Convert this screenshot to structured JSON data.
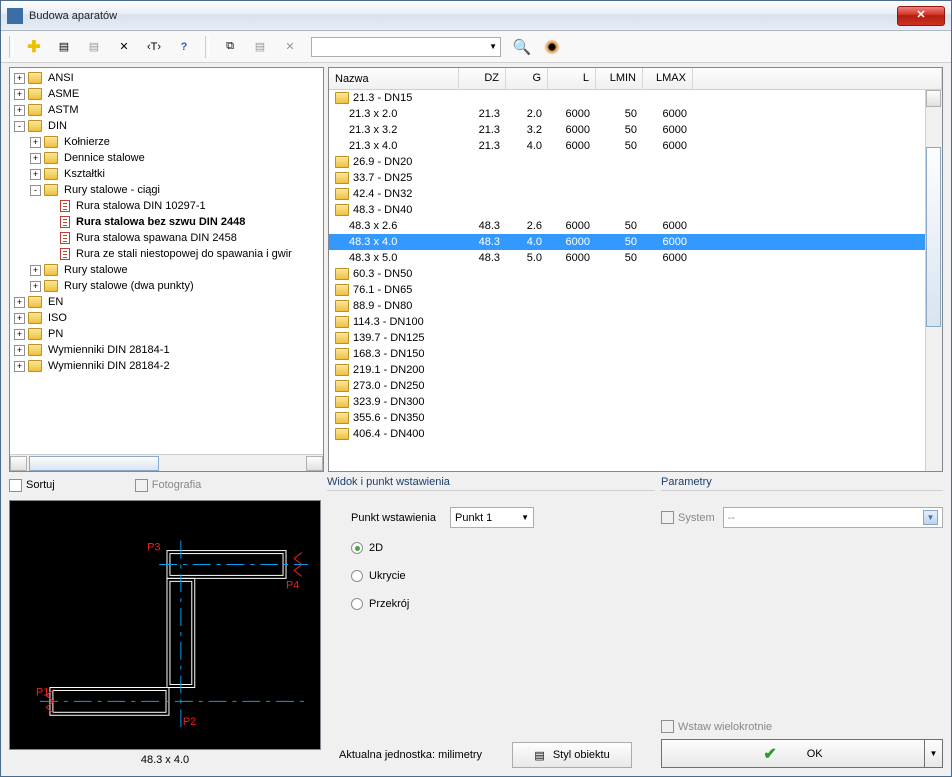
{
  "window": {
    "title": "Budowa aparatów"
  },
  "tree": [
    {
      "d": 0,
      "exp": "+",
      "icon": "folder",
      "label": "ANSI"
    },
    {
      "d": 0,
      "exp": "+",
      "icon": "folder",
      "label": "ASME"
    },
    {
      "d": 0,
      "exp": "+",
      "icon": "folder",
      "label": "ASTM"
    },
    {
      "d": 0,
      "exp": "-",
      "icon": "folder",
      "label": "DIN"
    },
    {
      "d": 1,
      "exp": "+",
      "icon": "folder",
      "label": "Kołnierze"
    },
    {
      "d": 1,
      "exp": "+",
      "icon": "folder",
      "label": "Dennice stalowe"
    },
    {
      "d": 1,
      "exp": "+",
      "icon": "folder",
      "label": "Kształtki"
    },
    {
      "d": 1,
      "exp": "-",
      "icon": "folder",
      "label": "Rury stalowe - ciągi"
    },
    {
      "d": 2,
      "exp": "",
      "icon": "doc",
      "label": "Rura stalowa DIN 10297-1"
    },
    {
      "d": 2,
      "exp": "",
      "icon": "doc",
      "label": "Rura stalowa bez szwu DIN 2448",
      "bold": true
    },
    {
      "d": 2,
      "exp": "",
      "icon": "doc",
      "label": "Rura stalowa spawana DIN 2458"
    },
    {
      "d": 2,
      "exp": "",
      "icon": "doc",
      "label": "Rura ze stali niestopowej do spawania i gwir"
    },
    {
      "d": 1,
      "exp": "+",
      "icon": "folder",
      "label": "Rury stalowe"
    },
    {
      "d": 1,
      "exp": "+",
      "icon": "folder",
      "label": "Rury stalowe (dwa punkty)"
    },
    {
      "d": 0,
      "exp": "+",
      "icon": "folder",
      "label": "EN"
    },
    {
      "d": 0,
      "exp": "+",
      "icon": "folder",
      "label": "ISO"
    },
    {
      "d": 0,
      "exp": "+",
      "icon": "folder",
      "label": "PN"
    },
    {
      "d": 0,
      "exp": "+",
      "icon": "folder",
      "label": "Wymienniki DIN 28184-1"
    },
    {
      "d": 0,
      "exp": "+",
      "icon": "folder",
      "label": "Wymienniki DIN 28184-2"
    }
  ],
  "list": {
    "cols": {
      "name": "Nazwa",
      "dz": "DZ",
      "g": "G",
      "l": "L",
      "lmin": "LMIN",
      "lmax": "LMAX"
    },
    "rows": [
      {
        "t": "g",
        "label": "21.3 - DN15"
      },
      {
        "t": "d",
        "label": "21.3 x 2.0",
        "dz": "21.3",
        "g": "2.0",
        "l": "6000",
        "lmin": "50",
        "lmax": "6000"
      },
      {
        "t": "d",
        "label": "21.3 x 3.2",
        "dz": "21.3",
        "g": "3.2",
        "l": "6000",
        "lmin": "50",
        "lmax": "6000"
      },
      {
        "t": "d",
        "label": "21.3 x 4.0",
        "dz": "21.3",
        "g": "4.0",
        "l": "6000",
        "lmin": "50",
        "lmax": "6000"
      },
      {
        "t": "g",
        "label": "26.9 - DN20"
      },
      {
        "t": "g",
        "label": "33.7 - DN25"
      },
      {
        "t": "g",
        "label": "42.4 - DN32"
      },
      {
        "t": "g",
        "label": "48.3 - DN40"
      },
      {
        "t": "d",
        "label": "48.3 x 2.6",
        "dz": "48.3",
        "g": "2.6",
        "l": "6000",
        "lmin": "50",
        "lmax": "6000"
      },
      {
        "t": "d",
        "label": "48.3 x 4.0",
        "dz": "48.3",
        "g": "4.0",
        "l": "6000",
        "lmin": "50",
        "lmax": "6000",
        "sel": true
      },
      {
        "t": "d",
        "label": "48.3 x 5.0",
        "dz": "48.3",
        "g": "5.0",
        "l": "6000",
        "lmin": "50",
        "lmax": "6000"
      },
      {
        "t": "g",
        "label": "60.3 - DN50"
      },
      {
        "t": "g",
        "label": "76.1 - DN65"
      },
      {
        "t": "g",
        "label": "88.9 - DN80"
      },
      {
        "t": "g",
        "label": "114.3 - DN100"
      },
      {
        "t": "g",
        "label": "139.7 - DN125"
      },
      {
        "t": "g",
        "label": "168.3 - DN150"
      },
      {
        "t": "g",
        "label": "219.1 - DN200"
      },
      {
        "t": "g",
        "label": "273.0 - DN250"
      },
      {
        "t": "g",
        "label": "323.9 - DN300"
      },
      {
        "t": "g",
        "label": "355.6 - DN350"
      },
      {
        "t": "g",
        "label": "406.4 - DN400"
      }
    ]
  },
  "preview": {
    "sort": "Sortuj",
    "photo": "Fotografia",
    "caption": "48.3 x 4.0",
    "points": {
      "p1": "P1",
      "p2": "P2",
      "p3": "P3",
      "p4": "P4"
    }
  },
  "mid": {
    "group": "Widok i punkt wstawienia",
    "pp_label": "Punkt wstawienia",
    "pp_value": "Punkt 1",
    "r1": "2D",
    "r2": "Ukrycie",
    "r3": "Przekrój",
    "unit": "Aktualna jednostka: milimetry",
    "style_btn": "Styl obiektu"
  },
  "right": {
    "group": "Parametry",
    "system": "System",
    "system_dd": "--",
    "multi": "Wstaw wielokrotnie",
    "ok": "OK"
  }
}
